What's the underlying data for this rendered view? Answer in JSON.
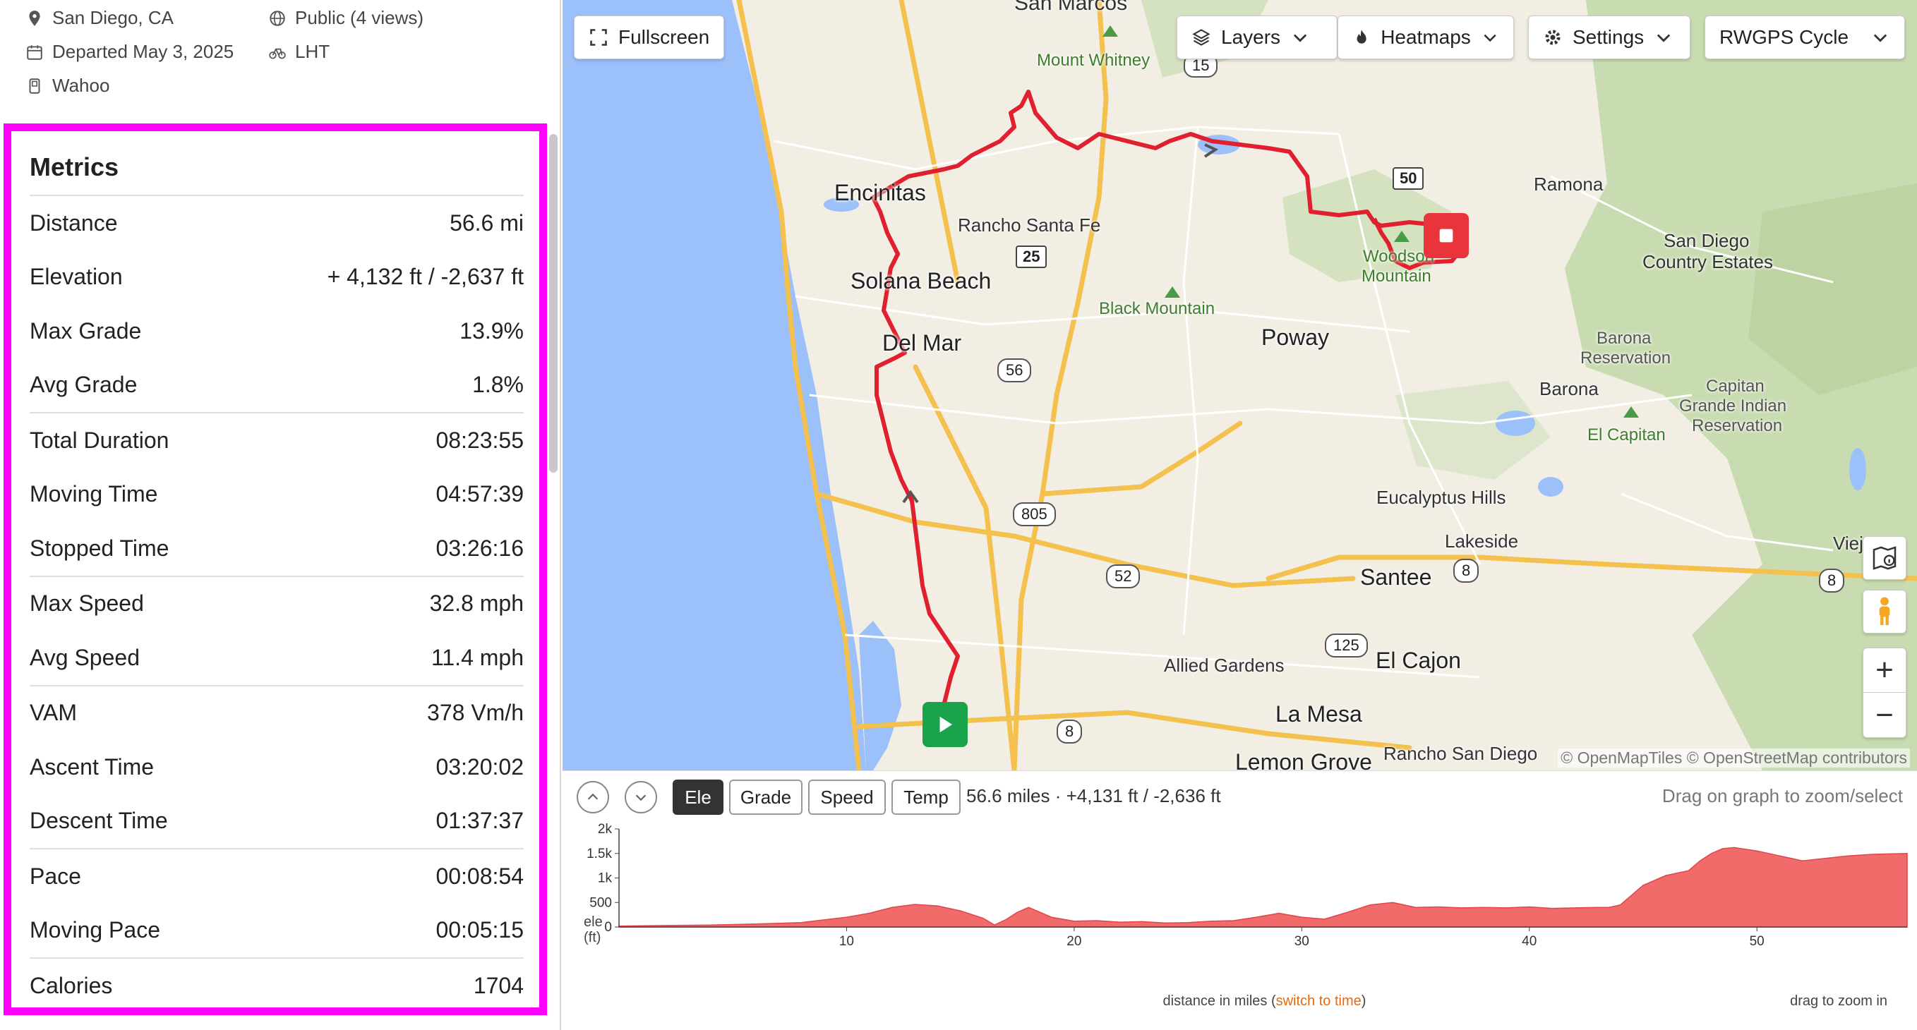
{
  "trip_info": {
    "location": "San Diego, CA",
    "departed": "Departed May 3, 2025",
    "device": "Wahoo",
    "privacy": "Public (4 views)",
    "bike": "LHT"
  },
  "metrics": {
    "title": "Metrics",
    "groups": [
      [
        {
          "label": "Distance",
          "value": "56.6 mi"
        },
        {
          "label": "Elevation",
          "value": "+ 4,132 ft / -2,637 ft"
        },
        {
          "label": "Max Grade",
          "value": "13.9%"
        },
        {
          "label": "Avg Grade",
          "value": "1.8%"
        }
      ],
      [
        {
          "label": "Total Duration",
          "value": "08:23:55"
        },
        {
          "label": "Moving Time",
          "value": "04:57:39"
        },
        {
          "label": "Stopped Time",
          "value": "03:26:16"
        }
      ],
      [
        {
          "label": "Max Speed",
          "value": "32.8 mph"
        },
        {
          "label": "Avg Speed",
          "value": "11.4 mph"
        }
      ],
      [
        {
          "label": "VAM",
          "value": "378 Vm/h"
        },
        {
          "label": "Ascent Time",
          "value": "03:20:02"
        },
        {
          "label": "Descent Time",
          "value": "01:37:37"
        }
      ],
      [
        {
          "label": "Pace",
          "value": "00:08:54"
        },
        {
          "label": "Moving Pace",
          "value": "00:05:15"
        }
      ],
      [
        {
          "label": "Calories",
          "value": "1704"
        }
      ]
    ]
  },
  "map": {
    "buttons": {
      "fullscreen": "Fullscreen",
      "layers": "Layers",
      "heatmaps": "Heatmaps",
      "settings": "Settings",
      "map_type": "RWGPS Cycle"
    },
    "places": {
      "san_marcos": "San Marcos",
      "mount_whitney": "Mount Whitney",
      "encinitas": "Encinitas",
      "rancho_santa_fe": "Rancho Santa Fe",
      "solana_beach": "Solana Beach",
      "del_mar": "Del Mar",
      "black_mountain": "Black Mountain",
      "poway": "Poway",
      "woodson_mountain_1": "Woodson",
      "woodson_mountain_2": "Mountain",
      "ramona": "Ramona",
      "san_diego_ce_1": "San Diego",
      "san_diego_ce_2": "Country Estates",
      "barona_res_1": "Barona",
      "barona_res_2": "Reservation",
      "barona": "Barona",
      "el_capitan": "El Capitan",
      "capitan_1": "Capitan",
      "capitan_2": "Grande Indian",
      "capitan_3": "Reservation",
      "eucalyptus_hills": "Eucalyptus Hills",
      "lakeside": "Lakeside",
      "santee": "Santee",
      "vieja": "Vieja",
      "el_cajon": "El Cajon",
      "allied_gardens": "Allied Gardens",
      "la_mesa": "La Mesa",
      "lemon_grove": "Lemon Grove",
      "rancho_san_diego": "Rancho San Diego"
    },
    "shields": {
      "s15": "15",
      "s56": "56",
      "s805": "805",
      "s52": "52",
      "s125": "125",
      "s8a": "8",
      "s8b": "8",
      "s8c": "8"
    },
    "mile_markers": {
      "m25": "25",
      "m50": "50"
    },
    "attribution": "© OpenMapTiles © OpenStreetMap contributors"
  },
  "elevation": {
    "tabs": {
      "ele": "Ele",
      "grade": "Grade",
      "speed": "Speed",
      "temp": "Temp"
    },
    "active_tab": "Ele",
    "summary": "56.6 miles · +4,131 ft / -2,636 ft",
    "hint": "Drag on graph to zoom/select",
    "y_axis_title_1": "ele",
    "y_axis_title_2": "(ft)",
    "x_label_prefix": "distance in miles (",
    "x_label_link": "switch to time",
    "x_label_suffix": ")",
    "drag_hint": "drag to zoom in",
    "fill_color": "#f26b6b"
  },
  "chart_data": {
    "type": "area",
    "xlabel": "distance in miles",
    "ylabel": "ele (ft)",
    "xlim": [
      0,
      56.6
    ],
    "ylim": [
      0,
      2000
    ],
    "x_ticks": [
      10,
      20,
      30,
      40,
      50
    ],
    "y_ticks": [
      {
        "v": 0,
        "t": "0"
      },
      {
        "v": 500,
        "t": "500"
      },
      {
        "v": 1000,
        "t": "1k"
      },
      {
        "v": 1500,
        "t": "1.5k"
      },
      {
        "v": 2000,
        "t": "2k"
      }
    ],
    "series": [
      {
        "x": [
          0,
          2,
          4,
          6,
          8,
          10,
          11,
          12,
          13,
          14,
          15,
          16,
          16.5,
          17,
          17.5,
          18,
          19,
          20,
          21,
          22,
          23,
          24,
          25,
          26,
          27,
          28,
          29,
          30,
          31,
          32,
          33,
          34,
          35,
          36,
          37,
          38,
          39,
          40,
          41,
          42,
          43,
          43.5,
          44,
          45,
          46,
          47,
          47.5,
          48,
          48.5,
          49,
          50,
          51,
          52,
          53,
          54,
          55,
          56.6
        ],
        "y": [
          20,
          30,
          40,
          60,
          90,
          200,
          280,
          400,
          460,
          430,
          330,
          180,
          40,
          150,
          300,
          400,
          200,
          120,
          130,
          100,
          110,
          80,
          90,
          120,
          130,
          200,
          280,
          200,
          160,
          300,
          450,
          500,
          400,
          410,
          390,
          400,
          390,
          410,
          380,
          390,
          400,
          400,
          450,
          850,
          1050,
          1150,
          1350,
          1500,
          1600,
          1620,
          1550,
          1450,
          1350,
          1400,
          1450,
          1480,
          1500
        ]
      }
    ]
  },
  "colors": {
    "route": "#e0202e",
    "water": "#9cc0f9",
    "highlight_border": "#ff00ff",
    "start": "#1aa34a",
    "end": "#e8343a"
  }
}
